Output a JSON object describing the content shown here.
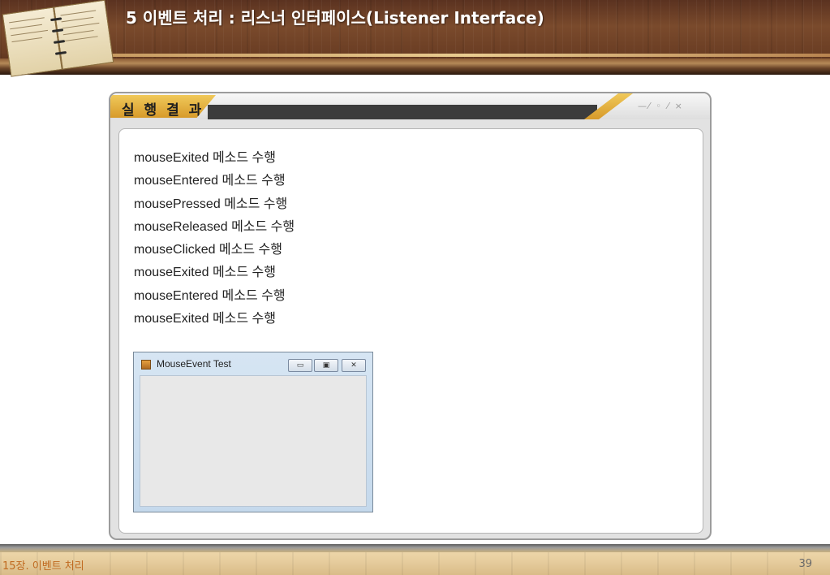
{
  "header": {
    "title": "5 이벤트 처리 : 리스너 인터페이스(Listener Interface)"
  },
  "panel": {
    "tab_label": "실 행 결 과",
    "window_controls": "—⁄ ◦ ⁄ ×"
  },
  "log_lines": [
    "mouseExited 메소드 수행",
    "mouseEntered 메소드 수행",
    "mousePressed 메소드 수행",
    "mouseReleased 메소드 수행",
    "mouseClicked 메소드 수행",
    "mouseExited 메소드 수행",
    "mouseEntered 메소드 수행",
    "mouseExited 메소드 수행"
  ],
  "java_window": {
    "title": "MouseEvent Test",
    "minimize_glyph": "▭",
    "maximize_glyph": "▣",
    "close_glyph": "✕",
    "icon": "java-cup-icon"
  },
  "footer": {
    "chapter": "15장. 이벤트 처리",
    "page": "39"
  },
  "colors": {
    "accent_gold": "#d79a2a",
    "footer_text": "#c06a20"
  }
}
